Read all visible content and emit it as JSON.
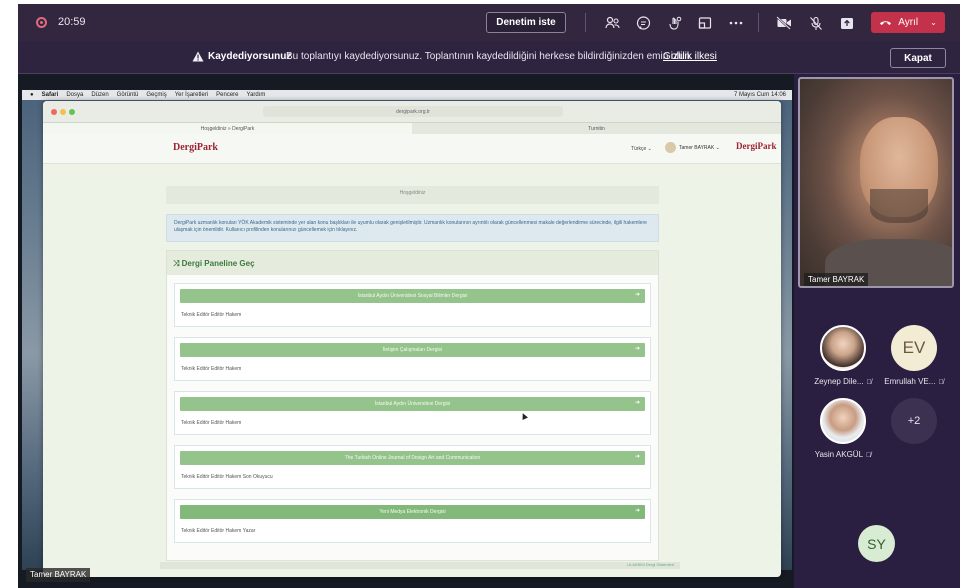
{
  "meeting": {
    "time": "20:59",
    "ask_control_label": "Denetim iste",
    "leave_label": "Ayrıl",
    "colors": {
      "leave": "#c4314b",
      "background": "#2a1f40"
    }
  },
  "toolbar_icons": [
    "people-icon",
    "chat-icon",
    "reactions-icon",
    "share-tray-icon",
    "more-icon",
    "camera-off-icon",
    "mic-off-icon",
    "share-icon"
  ],
  "banner": {
    "title": "Kaydediyorsunuz",
    "text": "Bu toplantıyı kaydediyorsunuz. Toplantının kaydedildiğini herkese bildirdiğinizden emin olun.",
    "link": "Gizlilik ilkesi",
    "close_label": "Kapat"
  },
  "shared_screen": {
    "mac_menu": [
      "Safari",
      "Dosya",
      "Düzen",
      "Görüntü",
      "Geçmiş",
      "Yer İşaretleri",
      "Pencere",
      "Yardım"
    ],
    "mac_clock": "7 Mayıs Cum 14:06",
    "address": "dergipark.org.tr",
    "tabs": [
      "Hoşgeldiniz » DergiPark",
      "Turnitin"
    ],
    "site": {
      "logo": "DergiPark",
      "lang": "Türkçe ⌄",
      "user": "Tamer BAYRAK ⌄",
      "welcome": "Hoşgeldiniz",
      "notice": "DergiPark uzmanlık konuları YÖK Akademik sisteminde yer alan konu başlıkları ile uyumlu olarak genişletilmiştir. Uzmanlık konularının ayrıntılı olarak güncellenmesi makale değerlendirme sürecinde, ilgili hakemlere ulaşmak için önemlidir. Kullanıcı profilinden konularınızı güncellemek için tıklayınız.",
      "panel_title": "Dergi Paneline Geç",
      "journals": [
        {
          "name": "İstanbul Aydın Üniversitesi Sosyal Bilimler Dergisi",
          "roles": "Teknik Editör Editör Hakem"
        },
        {
          "name": "İletişim Çalışmaları Dergisi",
          "roles": "Teknik Editör Editör Hakem"
        },
        {
          "name": "İstanbul Aydın Üniversitesi Dergisi",
          "roles": "Teknik Editör Editör Hakem"
        },
        {
          "name": "The Turkish Online Journal of Design Art and Communication",
          "roles": "Teknik Editör Editör Hakem Son Okuyucu"
        },
        {
          "name": "Yeni Medya Elektronik Dergisi",
          "roles": "Teknik Editör Editör Hakem Yazar"
        }
      ],
      "footer": "ULAKBİM Dergi Sistemleri"
    },
    "presenter": "Tamer BAYRAK"
  },
  "video": {
    "name": "Tamer BAYRAK"
  },
  "participants": [
    {
      "name": "Zeynep Dile...",
      "initials": ""
    },
    {
      "name": "Emrullah VE...",
      "initials": "EV"
    },
    {
      "name": "Yasin AKGÜL",
      "initials": ""
    },
    {
      "name": "",
      "initials": "+2"
    }
  ],
  "self": {
    "initials": "SY"
  }
}
